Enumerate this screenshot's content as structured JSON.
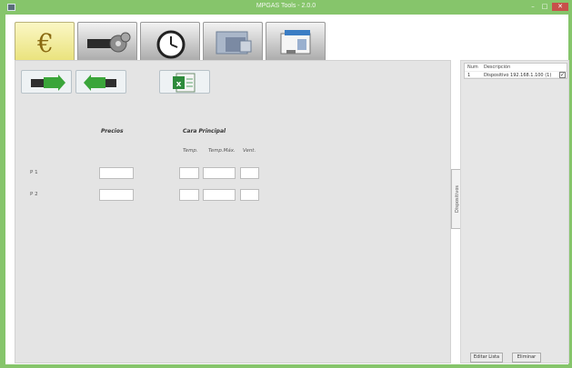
{
  "window": {
    "title": "MPGAS Tools - 2.0.0",
    "minimize_glyph": "–",
    "maximize_glyph": "□",
    "close_glyph": "✕"
  },
  "tabs": [
    {
      "icon": "euro-icon",
      "active": true
    },
    {
      "icon": "gears-icon",
      "active": false
    },
    {
      "icon": "clock-icon",
      "active": false
    },
    {
      "icon": "mpgas-logo-icon",
      "active": false
    },
    {
      "icon": "fuel-dispenser-icon",
      "active": false
    }
  ],
  "toolbar": {
    "buttons": [
      {
        "icon": "receive-arrow-icon"
      },
      {
        "icon": "send-arrow-icon"
      },
      {
        "icon": "excel-icon"
      }
    ]
  },
  "form": {
    "header_precios": "Precios",
    "header_cara": "Cara Principal",
    "sub_temp": "Temp.",
    "sub_tempmax": "Temp.Máx.",
    "sub_vent": "Vent.",
    "rows": [
      {
        "label": "P 1",
        "precio": "",
        "temp": "",
        "tempmax": "",
        "vent": ""
      },
      {
        "label": "P 2",
        "precio": "",
        "temp": "",
        "tempmax": "",
        "vent": ""
      }
    ]
  },
  "sidebar_tab": {
    "label": "Dispositivos"
  },
  "devices": {
    "columns": [
      "Num",
      "Descripción"
    ],
    "rows": [
      {
        "num": "1",
        "descripcion": "Dispositivo 192.168.1.100 (1)",
        "checked": true
      }
    ],
    "check_glyph": "✓",
    "edit_button": "Editar Lista",
    "delete_button": "Eliminar"
  },
  "colors": {
    "titlebar": "#86c56b",
    "active_tab": "#e9e27a",
    "close_button": "#c7504a",
    "panel": "#e4e4e4"
  }
}
